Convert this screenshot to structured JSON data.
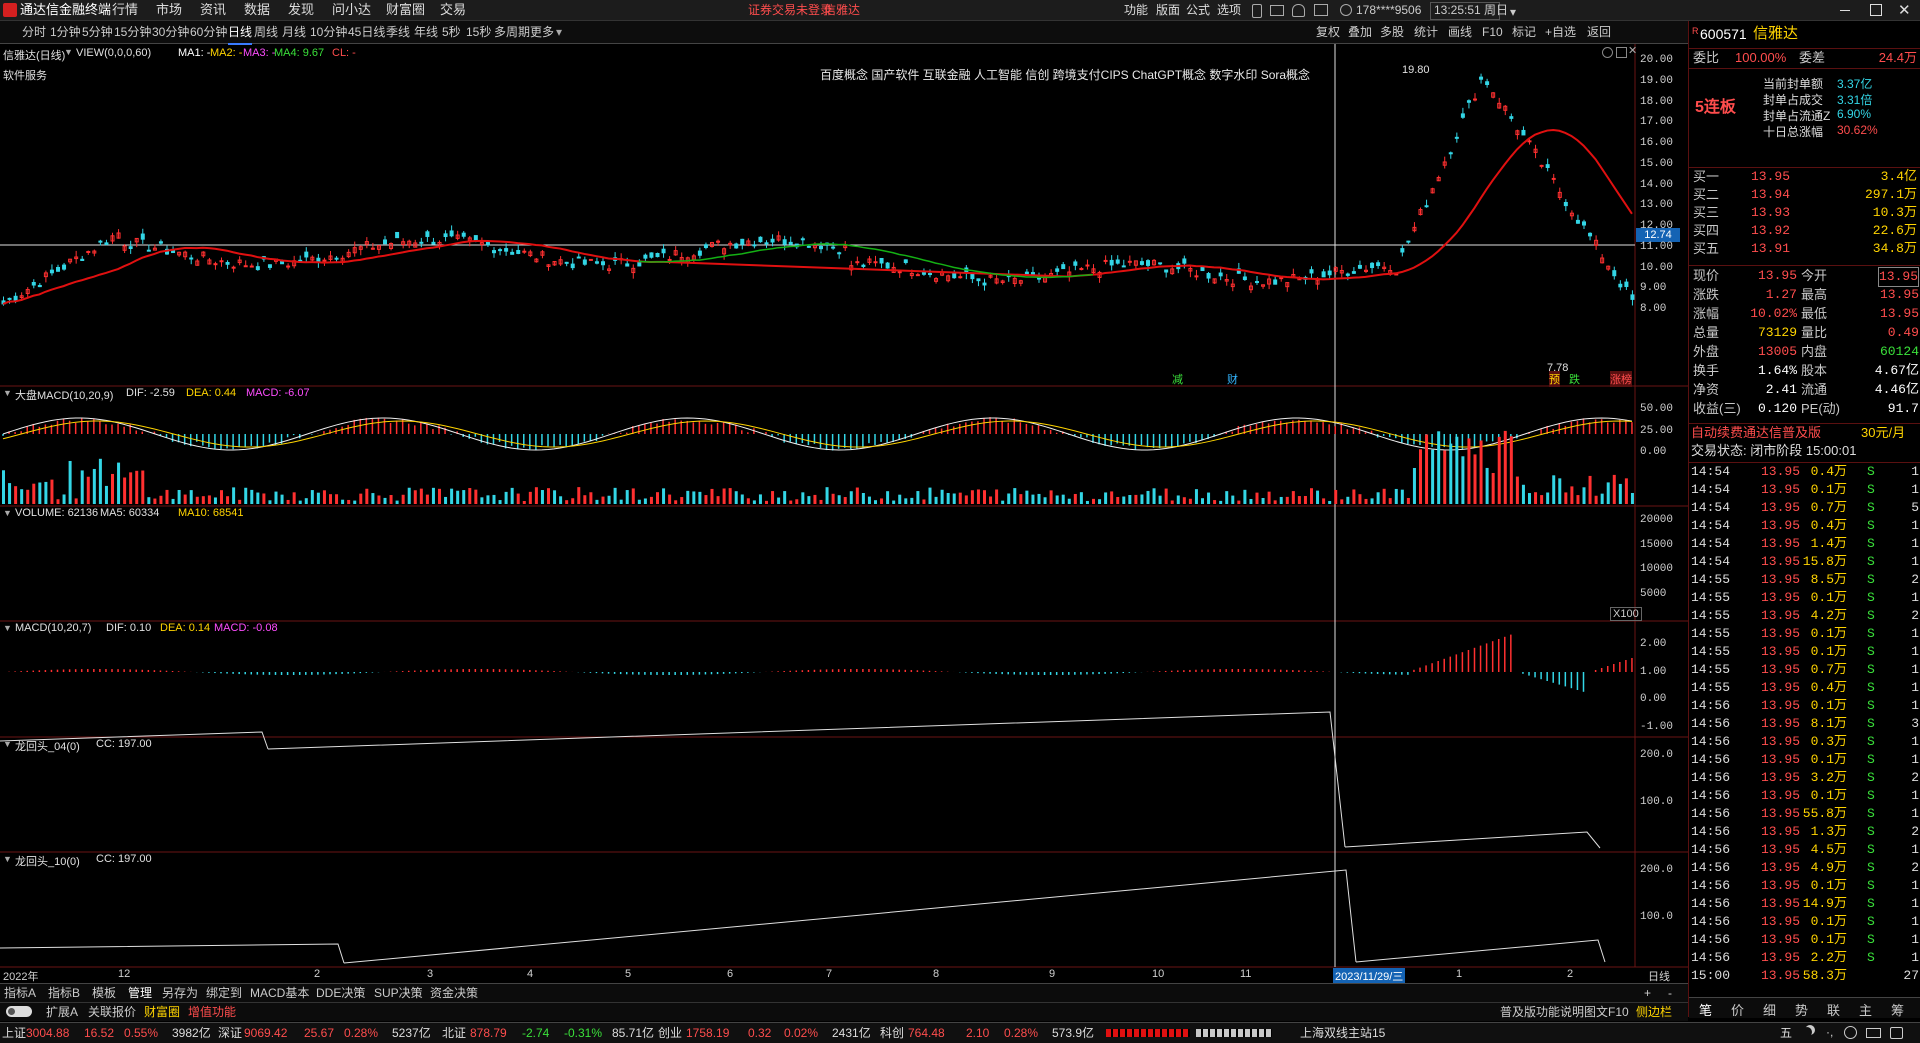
{
  "app": {
    "title": "通达信金融终端",
    "menus": [
      "行情",
      "市场",
      "资讯",
      "数据",
      "发现",
      "问小达",
      "财富圈",
      "交易"
    ],
    "notice": "证券交易未登录",
    "notice_name": "信雅达",
    "right_menus": [
      "功能",
      "版面",
      "公式",
      "选项"
    ],
    "account": "178****9506",
    "clock": "13:25:51 周日"
  },
  "periods": [
    "分时",
    "1分钟",
    "5分钟",
    "15分钟",
    "30分钟",
    "60分钟",
    "日线",
    "周线",
    "月线",
    "10分钟",
    "45日线",
    "季线",
    "年线",
    "5秒",
    "15秒",
    "多周期",
    "更多"
  ],
  "active_period": "日线",
  "toolbar": [
    "复权",
    "叠加",
    "多股",
    "统计",
    "画线",
    "F10",
    "标记",
    "+自选",
    "返回"
  ],
  "main": {
    "header": "信雅达(日线)",
    "view": "VIEW(0,0,0,60)",
    "ma_labels": [
      {
        "text": "MA1: -",
        "color": "#ffffff"
      },
      {
        "text": "MA2: -",
        "color": "#ffd400"
      },
      {
        "text": "MA3: -",
        "color": "#ff4dff"
      },
      {
        "text": "MA4: 9.67",
        "color": "#3ae03a"
      },
      {
        "text": "CL: -",
        "color": "#ff4d4d"
      }
    ],
    "sector": "软件服务",
    "concepts": "百度概念 国产软件 互联金融 人工智能 信创 跨境支付CIPS ChatGPT概念 数字水印 Sora概念",
    "high_label": "19.80",
    "low_label": "7.78",
    "cursor_price": "12.74",
    "y_ticks": [
      "20.00",
      "19.00",
      "18.00",
      "17.00",
      "16.00",
      "15.00",
      "14.00",
      "13.00",
      "12.00",
      "11.00",
      "10.00",
      "9.00",
      "8.00"
    ],
    "markers": [
      {
        "text": "减",
        "color": "#3ae03a"
      },
      {
        "text": "财",
        "color": "#33b5ff"
      },
      {
        "text": "预",
        "color": "#ffd400"
      },
      {
        "text": "跌",
        "color": "#3ae03a"
      },
      {
        "text": "涨榜",
        "color": "#ff4d4d"
      }
    ]
  },
  "macd1": {
    "name": "大盘MACD(10,20,9)",
    "dif": "DIF: -2.59",
    "dea": "DEA: 0.44",
    "macd": "MACD: -6.07",
    "y_ticks": [
      "50.00",
      "25.00",
      "0.00"
    ]
  },
  "volume": {
    "name": "VOLUME: 62136",
    "ma5": "MA5: 60334",
    "ma10": "MA10: 68541",
    "y_ticks": [
      "20000",
      "15000",
      "10000",
      "5000"
    ],
    "unit": "X100"
  },
  "macd2": {
    "name": "MACD(10,20,7)",
    "dif": "DIF: 0.10",
    "dea": "DEA: 0.14",
    "macd": "MACD: -0.08",
    "y_ticks": [
      "2.00",
      "1.00",
      "0.00",
      "-1.00"
    ]
  },
  "dht04": {
    "name": "龙回头_04(0)",
    "cc": "CC: 197.00",
    "y_ticks": [
      "200.0",
      "100.0"
    ]
  },
  "dht10": {
    "name": "龙回头_10(0)",
    "cc": "CC: 197.00",
    "y_ticks": [
      "200.0",
      "100.0"
    ]
  },
  "xaxis": {
    "labels": [
      "2022年",
      "12",
      "2",
      "3",
      "4",
      "5",
      "6",
      "7",
      "8",
      "9",
      "10",
      "11",
      "1",
      "2"
    ],
    "cursor_date": "2023/11/29/三",
    "right_label": "日线"
  },
  "bottom_tabs": [
    "指标A",
    "指标B",
    "模板",
    "管理",
    "另存为",
    "绑定到",
    "MACD基本",
    "DDE决策",
    "SUP决策",
    "资金决策"
  ],
  "bottom_tabs2": [
    "扩展A",
    "关联报价",
    "财富圈",
    "增值功能"
  ],
  "quote": {
    "code": "600571",
    "name": "信雅达",
    "weibi_label": "委比",
    "weibi": "100.00%",
    "weicha_label": "委差",
    "weicha": "24.4万",
    "streak": "5连板",
    "seal": [
      {
        "label": "当前封单额",
        "value": "3.37亿"
      },
      {
        "label": "封单占成交",
        "value": "3.31倍"
      },
      {
        "label": "封单占流通Z",
        "value": "6.90%"
      },
      {
        "label": "十日总涨幅",
        "value": "30.62%"
      }
    ],
    "bids": [
      {
        "label": "买一",
        "price": "13.95",
        "vol": "3.4亿"
      },
      {
        "label": "买二",
        "price": "13.94",
        "vol": "297.1万"
      },
      {
        "label": "买三",
        "price": "13.93",
        "vol": "10.3万"
      },
      {
        "label": "买四",
        "price": "13.92",
        "vol": "22.6万"
      },
      {
        "label": "买五",
        "price": "13.91",
        "vol": "34.8万"
      }
    ],
    "stats": [
      {
        "l1": "现价",
        "v1": "13.95",
        "l2": "今开",
        "v2": "13.95"
      },
      {
        "l1": "涨跌",
        "v1": "1.27",
        "l2": "最高",
        "v2": "13.95"
      },
      {
        "l1": "涨幅",
        "v1": "10.02%",
        "l2": "最低",
        "v2": "13.95"
      },
      {
        "l1": "总量",
        "v1": "73129",
        "l2": "量比",
        "v2": "0.49"
      },
      {
        "l1": "外盘",
        "v1": "13005",
        "l2": "内盘",
        "v2": "60124"
      },
      {
        "l1": "换手",
        "v1": "1.64%",
        "l2": "股本",
        "v2": "4.67亿"
      },
      {
        "l1": "净资",
        "v1": "2.41",
        "l2": "流通",
        "v2": "4.46亿"
      },
      {
        "l1": "收益(三)",
        "v1": "0.120",
        "l2": "PE(动)",
        "v2": "91.7"
      }
    ],
    "promo": "自动续费通达信普及版",
    "promo_price": "30元/月",
    "trade_state": "交易状态: 闭市阶段 15:00:01"
  },
  "ticks": [
    {
      "t": "14:54",
      "p": "13.95",
      "v": "0.4万",
      "s": "S",
      "n": "1"
    },
    {
      "t": "14:54",
      "p": "13.95",
      "v": "0.1万",
      "s": "S",
      "n": "1"
    },
    {
      "t": "14:54",
      "p": "13.95",
      "v": "0.7万",
      "s": "S",
      "n": "5"
    },
    {
      "t": "14:54",
      "p": "13.95",
      "v": "0.4万",
      "s": "S",
      "n": "1"
    },
    {
      "t": "14:54",
      "p": "13.95",
      "v": "1.4万",
      "s": "S",
      "n": "1"
    },
    {
      "t": "14:54",
      "p": "13.95",
      "v": "15.8万",
      "s": "S",
      "n": "1"
    },
    {
      "t": "14:55",
      "p": "13.95",
      "v": "8.5万",
      "s": "S",
      "n": "2"
    },
    {
      "t": "14:55",
      "p": "13.95",
      "v": "0.1万",
      "s": "S",
      "n": "1"
    },
    {
      "t": "14:55",
      "p": "13.95",
      "v": "4.2万",
      "s": "S",
      "n": "2"
    },
    {
      "t": "14:55",
      "p": "13.95",
      "v": "0.1万",
      "s": "S",
      "n": "1"
    },
    {
      "t": "14:55",
      "p": "13.95",
      "v": "0.1万",
      "s": "S",
      "n": "1"
    },
    {
      "t": "14:55",
      "p": "13.95",
      "v": "0.7万",
      "s": "S",
      "n": "1"
    },
    {
      "t": "14:55",
      "p": "13.95",
      "v": "0.4万",
      "s": "S",
      "n": "1"
    },
    {
      "t": "14:56",
      "p": "13.95",
      "v": "0.1万",
      "s": "S",
      "n": "1"
    },
    {
      "t": "14:56",
      "p": "13.95",
      "v": "8.1万",
      "s": "S",
      "n": "3"
    },
    {
      "t": "14:56",
      "p": "13.95",
      "v": "0.3万",
      "s": "S",
      "n": "1"
    },
    {
      "t": "14:56",
      "p": "13.95",
      "v": "0.1万",
      "s": "S",
      "n": "1"
    },
    {
      "t": "14:56",
      "p": "13.95",
      "v": "3.2万",
      "s": "S",
      "n": "2"
    },
    {
      "t": "14:56",
      "p": "13.95",
      "v": "0.1万",
      "s": "S",
      "n": "1"
    },
    {
      "t": "14:56",
      "p": "13.95",
      "v": "55.8万",
      "s": "S",
      "n": "1"
    },
    {
      "t": "14:56",
      "p": "13.95",
      "v": "1.3万",
      "s": "S",
      "n": "2"
    },
    {
      "t": "14:56",
      "p": "13.95",
      "v": "4.5万",
      "s": "S",
      "n": "1"
    },
    {
      "t": "14:56",
      "p": "13.95",
      "v": "4.9万",
      "s": "S",
      "n": "2"
    },
    {
      "t": "14:56",
      "p": "13.95",
      "v": "0.1万",
      "s": "S",
      "n": "1"
    },
    {
      "t": "14:56",
      "p": "13.95",
      "v": "14.9万",
      "s": "S",
      "n": "1"
    },
    {
      "t": "14:56",
      "p": "13.95",
      "v": "0.1万",
      "s": "S",
      "n": "1"
    },
    {
      "t": "14:56",
      "p": "13.95",
      "v": "0.1万",
      "s": "S",
      "n": "1"
    },
    {
      "t": "14:56",
      "p": "13.95",
      "v": "2.2万",
      "s": "S",
      "n": "1"
    },
    {
      "t": "15:00",
      "p": "13.95",
      "v": "58.3万",
      "s": "",
      "n": "27"
    }
  ],
  "rp_tabs": [
    "笔",
    "价",
    "细",
    "势",
    "联",
    "主",
    "筹"
  ],
  "status": {
    "indices": [
      {
        "name": "上证",
        "val": "3004.88",
        "chg": "16.52",
        "pct": "0.55%",
        "amt": "3982亿"
      },
      {
        "name": "深证",
        "val": "9069.42",
        "chg": "25.67",
        "pct": "0.28%",
        "amt": "5237亿"
      },
      {
        "name": "北证",
        "val": "878.79",
        "chg": "-2.74",
        "pct": "-0.31%",
        "amt": "85.71亿"
      },
      {
        "name": "创业",
        "val": "1758.19",
        "chg": "0.32",
        "pct": "0.02%",
        "amt": "2431亿"
      },
      {
        "name": "科创",
        "val": "764.48",
        "chg": "2.10",
        "pct": "0.28%",
        "amt": "573.9亿"
      }
    ],
    "server": "上海双线主站15",
    "help": "普及版功能说明",
    "f10": "图文F10",
    "sidebar": "侧边栏",
    "ime": "五"
  },
  "colors": {
    "up": "#ff4d4d",
    "down": "#33d6e6",
    "ma_red": "#e01010",
    "ma_green": "#14b014",
    "bg": "#000000",
    "grid": "#5a1010"
  }
}
